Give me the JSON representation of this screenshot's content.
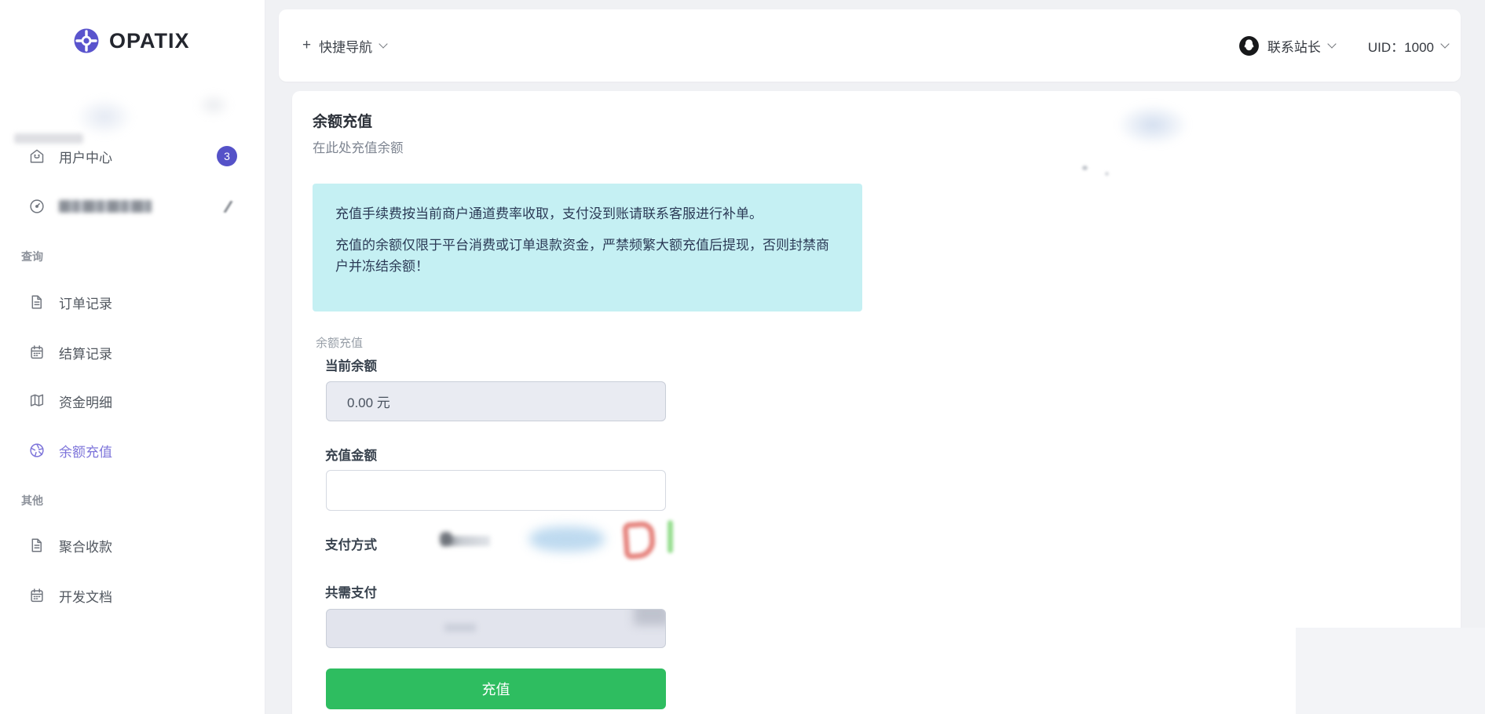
{
  "brand": {
    "name": "OPATIX"
  },
  "topbar": {
    "quick_nav": {
      "plus": "+",
      "label": "快捷导航"
    },
    "contact_label": "联系站长",
    "uid_label": "UID：1000"
  },
  "sidebar": {
    "groups": [
      {
        "header": "",
        "items": [
          {
            "label": "用户中心",
            "icon": "home-icon",
            "badge": "3"
          },
          {
            "label": "",
            "icon": "gauge-icon",
            "censored": true
          }
        ]
      },
      {
        "header": "查询",
        "items": [
          {
            "label": "订单记录",
            "icon": "file-icon"
          },
          {
            "label": "结算记录",
            "icon": "calendar-icon"
          },
          {
            "label": "资金明细",
            "icon": "map-icon"
          },
          {
            "label": "余额充值",
            "icon": "shutter-icon",
            "active": true
          }
        ]
      },
      {
        "header": "其他",
        "items": [
          {
            "label": "聚合收款",
            "icon": "file-icon"
          },
          {
            "label": "开发文档",
            "icon": "calendar-icon"
          }
        ]
      }
    ]
  },
  "main": {
    "title": "余额充值",
    "subtitle": "在此处充值余额",
    "notice": [
      "充值手续费按当前商户通道费率收取，支付没到账请联系客服进行补单。",
      "充值的余额仅限于平台消费或订单退款资金，严禁频繁大额充值后提现，否则封禁商户并冻结余额！"
    ],
    "form": {
      "legend": "余额充值",
      "current_balance": {
        "label": "当前余额",
        "value": "0.00 元"
      },
      "amount": {
        "label": "充值金额",
        "value": ""
      },
      "payment_method": {
        "label": "支付方式"
      },
      "total": {
        "label": "共需支付",
        "value": ""
      },
      "submit_label": "充值"
    }
  },
  "colors": {
    "accent_purple": "#5a54cd",
    "active_item": "#7d74da",
    "badge_bg": "#5552c8",
    "notice_bg": "#c5f0f3",
    "notice_text": "#2b3a56",
    "button_green": "#2ebd60"
  }
}
